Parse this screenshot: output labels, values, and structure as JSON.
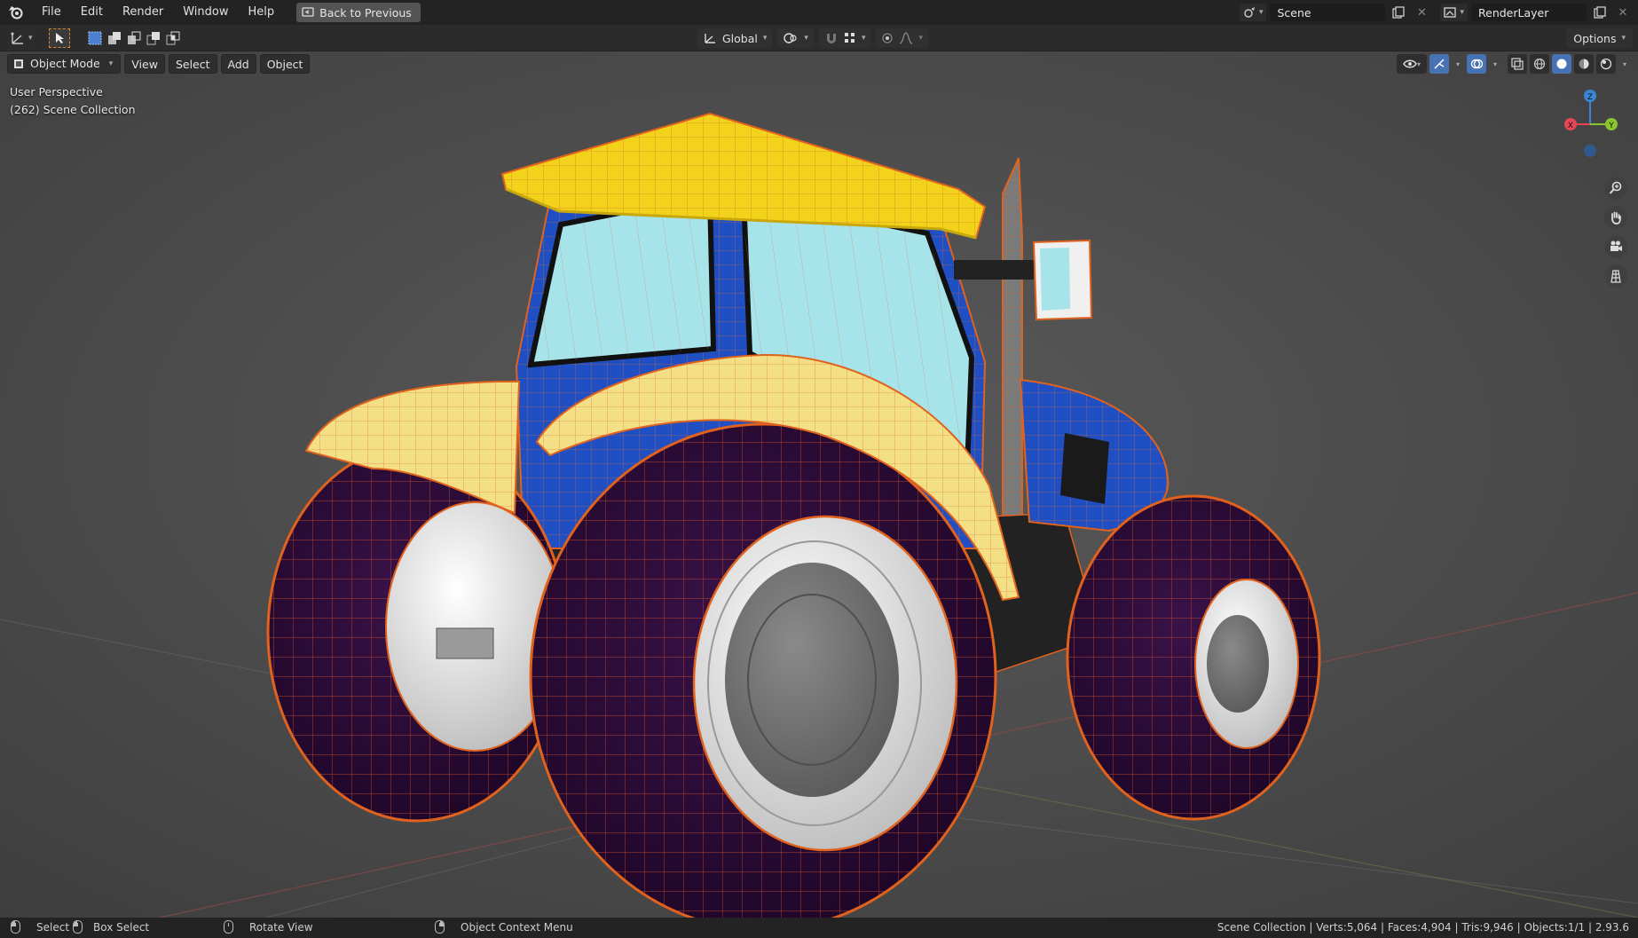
{
  "topbar": {
    "menus": [
      "File",
      "Edit",
      "Render",
      "Window",
      "Help"
    ],
    "back_button": "Back to Previous",
    "scene_name": "Scene",
    "render_layer": "RenderLayer"
  },
  "tool_header": {
    "transform_orientation": "Global",
    "options_label": "Options"
  },
  "viewport": {
    "mode": "Object Mode",
    "menus": [
      "View",
      "Select",
      "Add",
      "Object"
    ],
    "perspective_label": "User Perspective",
    "collection_label": "(262) Scene Collection",
    "gizmo": {
      "x": "X",
      "y": "Y",
      "z": "Z"
    }
  },
  "statusbar": {
    "select": "Select",
    "box_select": "Box Select",
    "rotate_view": "Rotate View",
    "context_menu": "Object Context Menu",
    "stats": "Scene Collection | Verts:5,064 | Faces:4,904 | Tris:9,946 | Objects:1/1 | 2.93.6"
  },
  "colors": {
    "cab_roof": "#f2d21a",
    "cab_body": "#1f4fc2",
    "glass": "#a6e4ea",
    "fender": "#f3e086",
    "tire": "#2b0a36",
    "rim": "#e9e9e9",
    "selection_outline": "#e0621d",
    "axis_x": "#e64553",
    "axis_y": "#8ac62f",
    "axis_z": "#3b86d6"
  }
}
